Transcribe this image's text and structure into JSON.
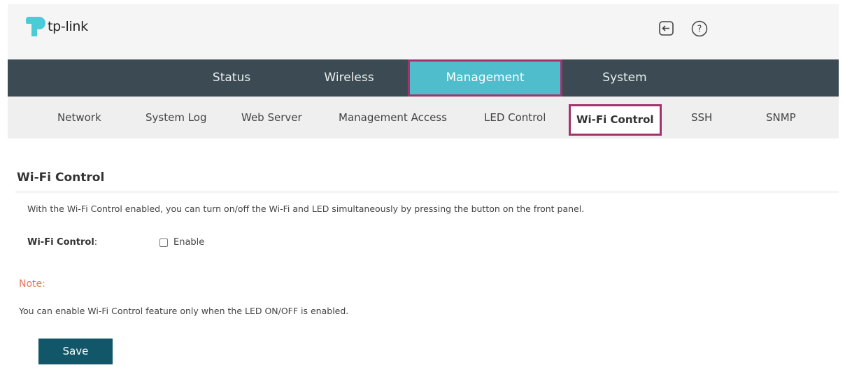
{
  "header": {
    "brand": "tp-link",
    "icons": [
      "logout-icon",
      "help-icon"
    ]
  },
  "main_nav": {
    "tabs": [
      {
        "label": "Status"
      },
      {
        "label": "Wireless"
      },
      {
        "label": "Management",
        "active": true
      },
      {
        "label": "System"
      }
    ]
  },
  "sub_nav": {
    "items": [
      {
        "label": "Network"
      },
      {
        "label": "System Log"
      },
      {
        "label": "Web Server"
      },
      {
        "label": "Management Access"
      },
      {
        "label": "LED Control"
      },
      {
        "label": "Wi-Fi Control",
        "active": true
      },
      {
        "label": "SSH"
      },
      {
        "label": "SNMP"
      }
    ]
  },
  "content": {
    "title": "Wi-Fi Control",
    "description": "With the Wi-Fi Control enabled, you can turn on/off the Wi-Fi and LED simultaneously by pressing the button on the front panel.",
    "field_label": "Wi-Fi Control",
    "field_colon": ":",
    "checkbox_label": "Enable",
    "checkbox_checked": false,
    "note_title": "Note:",
    "note_text": "You can enable Wi-Fi Control feature only when the LED ON/OFF is enabled.",
    "save_label": "Save"
  },
  "colors": {
    "nav_bg": "#3c4b53",
    "active_tab_bg": "#4fbdcc",
    "highlight_border": "#a3336d",
    "save_button_bg": "#12566a",
    "note_color": "#e8745a"
  }
}
